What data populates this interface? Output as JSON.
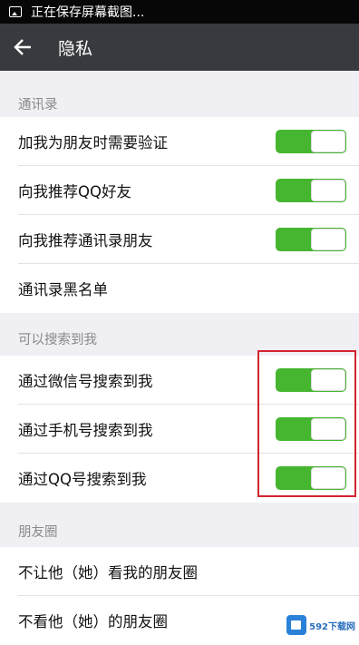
{
  "status_bar": {
    "text": "正在保存屏幕截图..."
  },
  "header": {
    "title": "隐私"
  },
  "sections": [
    {
      "title": "通讯录",
      "items": [
        {
          "label": "加我为朋友时需要验证",
          "toggle_on": true
        },
        {
          "label": "向我推荐QQ好友",
          "toggle_on": true
        },
        {
          "label": "向我推荐通讯录朋友",
          "toggle_on": true
        },
        {
          "label": "通讯录黑名单"
        }
      ]
    },
    {
      "title": "可以搜索到我",
      "items": [
        {
          "label": "通过微信号搜索到我",
          "toggle_on": true
        },
        {
          "label": "通过手机号搜索到我",
          "toggle_on": true
        },
        {
          "label": "通过QQ号搜索到我",
          "toggle_on": true
        }
      ]
    },
    {
      "title": "朋友圈",
      "items": [
        {
          "label": "不让他（她）看我的朋友圈"
        },
        {
          "label": "不看他（她）的朋友圈"
        }
      ]
    }
  ],
  "watermark": {
    "text": "592下载网"
  },
  "colors": {
    "toggle_on": "#46b530",
    "highlight": "#d4232f",
    "app_bar": "#393a3f"
  }
}
